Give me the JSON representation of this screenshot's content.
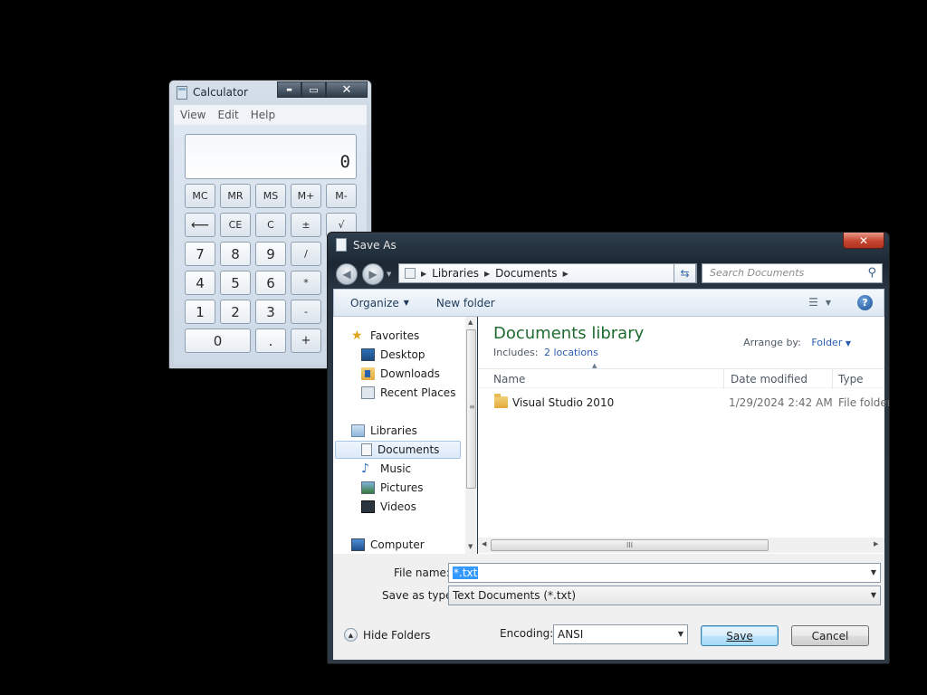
{
  "calculator": {
    "title": "Calculator",
    "menu": [
      "View",
      "Edit",
      "Help"
    ],
    "display": "0",
    "controls": {
      "minimize": "▬",
      "maximize": "▭",
      "close": "✕"
    },
    "rows": [
      [
        "MC",
        "MR",
        "MS",
        "M+",
        "M-"
      ],
      [
        "⟵",
        "CE",
        "C",
        "±",
        "√"
      ],
      [
        "7",
        "8",
        "9",
        "/"
      ],
      [
        "4",
        "5",
        "6",
        "*"
      ],
      [
        "1",
        "2",
        "3",
        "-"
      ],
      [
        "0",
        ".",
        "+"
      ]
    ]
  },
  "save_dialog": {
    "title": "Save As",
    "close": "✕",
    "breadcrumb": [
      "Libraries",
      "Documents"
    ],
    "search_placeholder": "Search Documents",
    "toolbar": {
      "organize": "Organize",
      "new_folder": "New folder"
    },
    "nav": {
      "favorites_header": "Favorites",
      "favorites": [
        "Desktop",
        "Downloads",
        "Recent Places"
      ],
      "libraries_header": "Libraries",
      "libraries": [
        "Documents",
        "Music",
        "Pictures",
        "Videos"
      ],
      "computer": "Computer"
    },
    "library_title": "Documents library",
    "includes_label": "Includes:",
    "includes_link": "2 locations",
    "arrange_label": "Arrange by:",
    "arrange_value": "Folder",
    "columns": [
      "Name",
      "Date modified",
      "Type"
    ],
    "files": [
      {
        "name": "Visual Studio 2010",
        "date": "1/29/2024 2:42 AM",
        "type": "File folder"
      }
    ],
    "scroll_grip": "III",
    "file_name_label": "File name:",
    "file_name_value": "*.txt",
    "save_type_label": "Save as type:",
    "save_type_value": "Text Documents (*.txt)",
    "hide_folders": "Hide Folders",
    "encoding_label": "Encoding:",
    "encoding_value": "ANSI",
    "save_button": "Save",
    "cancel_button": "Cancel"
  }
}
